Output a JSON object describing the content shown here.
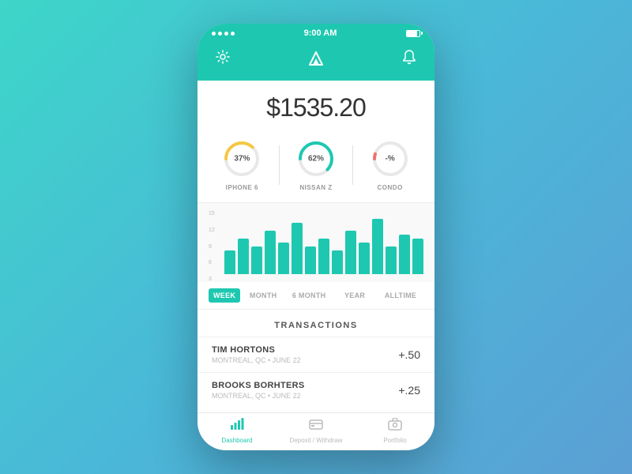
{
  "statusBar": {
    "time": "9:00 AM",
    "dots": 4
  },
  "header": {
    "settingsIcon": "⚙",
    "notificationIcon": "🔔"
  },
  "balance": {
    "amount": "$1535.20"
  },
  "gauges": [
    {
      "id": "iphone6",
      "label": "37%",
      "name": "IPHONE 6",
      "percent": 37,
      "color": "#f5c842"
    },
    {
      "id": "nissanz",
      "label": "62%",
      "name": "NISSAN Z",
      "percent": 62,
      "color": "#1ec8b0"
    },
    {
      "id": "condo",
      "label": "-%",
      "name": "CONDO",
      "percent": 5,
      "color": "#f07070"
    }
  ],
  "chart": {
    "yLabels": [
      "15",
      "12",
      "9",
      "6",
      "3"
    ],
    "bars": [
      6,
      9,
      7,
      11,
      8,
      13,
      7,
      9,
      6,
      11,
      8,
      14,
      7,
      10,
      9
    ]
  },
  "timeTabs": [
    {
      "label": "WEEK",
      "active": true
    },
    {
      "label": "MONTH",
      "active": false
    },
    {
      "label": "6 MONTH",
      "active": false
    },
    {
      "label": "YEAR",
      "active": false
    },
    {
      "label": "ALLTIME",
      "active": false
    }
  ],
  "transactions": {
    "title": "TRANSACTIONS",
    "items": [
      {
        "name": "TIM HORTONS",
        "sub": "MONTREAL, QC  •  JUNE 22",
        "amount": "+.50"
      },
      {
        "name": "BROOKS BORHTERS",
        "sub": "MONTREAL, QC  •  JUNE 22",
        "amount": "+.25"
      }
    ]
  },
  "bottomNav": [
    {
      "id": "dashboard",
      "label": "Dashboard",
      "active": true
    },
    {
      "id": "deposit",
      "label": "Deposit / Withdraw",
      "active": false
    },
    {
      "id": "portfolio",
      "label": "Portfolio",
      "active": false
    }
  ]
}
